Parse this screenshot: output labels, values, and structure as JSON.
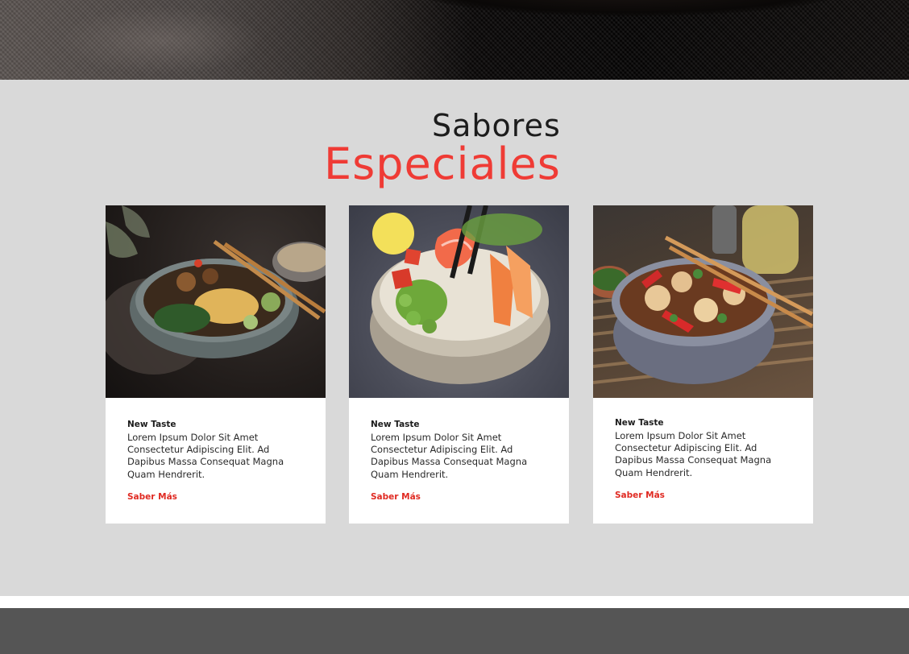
{
  "section": {
    "title_line1": "Sabores",
    "title_line2": "Especiales"
  },
  "cards": [
    {
      "kicker": "New Taste",
      "description": "Lorem Ipsum Dolor Sit Amet Consectetur Adipiscing Elit. Ad Dapibus Massa Consequat Magna Quam Hendrerit.",
      "link_label": "Saber Más"
    },
    {
      "kicker": "New Taste",
      "description": "Lorem Ipsum Dolor Sit Amet Consectetur Adipiscing Elit. Ad Dapibus Massa Consequat Magna Quam Hendrerit.",
      "link_label": "Saber Más"
    },
    {
      "kicker": "New Taste",
      "description": "Lorem Ipsum Dolor Sit Amet Consectetur Adipiscing Elit. Ad Dapibus Massa Consequat Magna Quam Hendrerit.",
      "link_label": "Saber Más"
    }
  ],
  "colors": {
    "accent": "#ef3b35",
    "link": "#e02a22",
    "section_bg": "#d9d9d9",
    "footer_bg": "#555555"
  }
}
